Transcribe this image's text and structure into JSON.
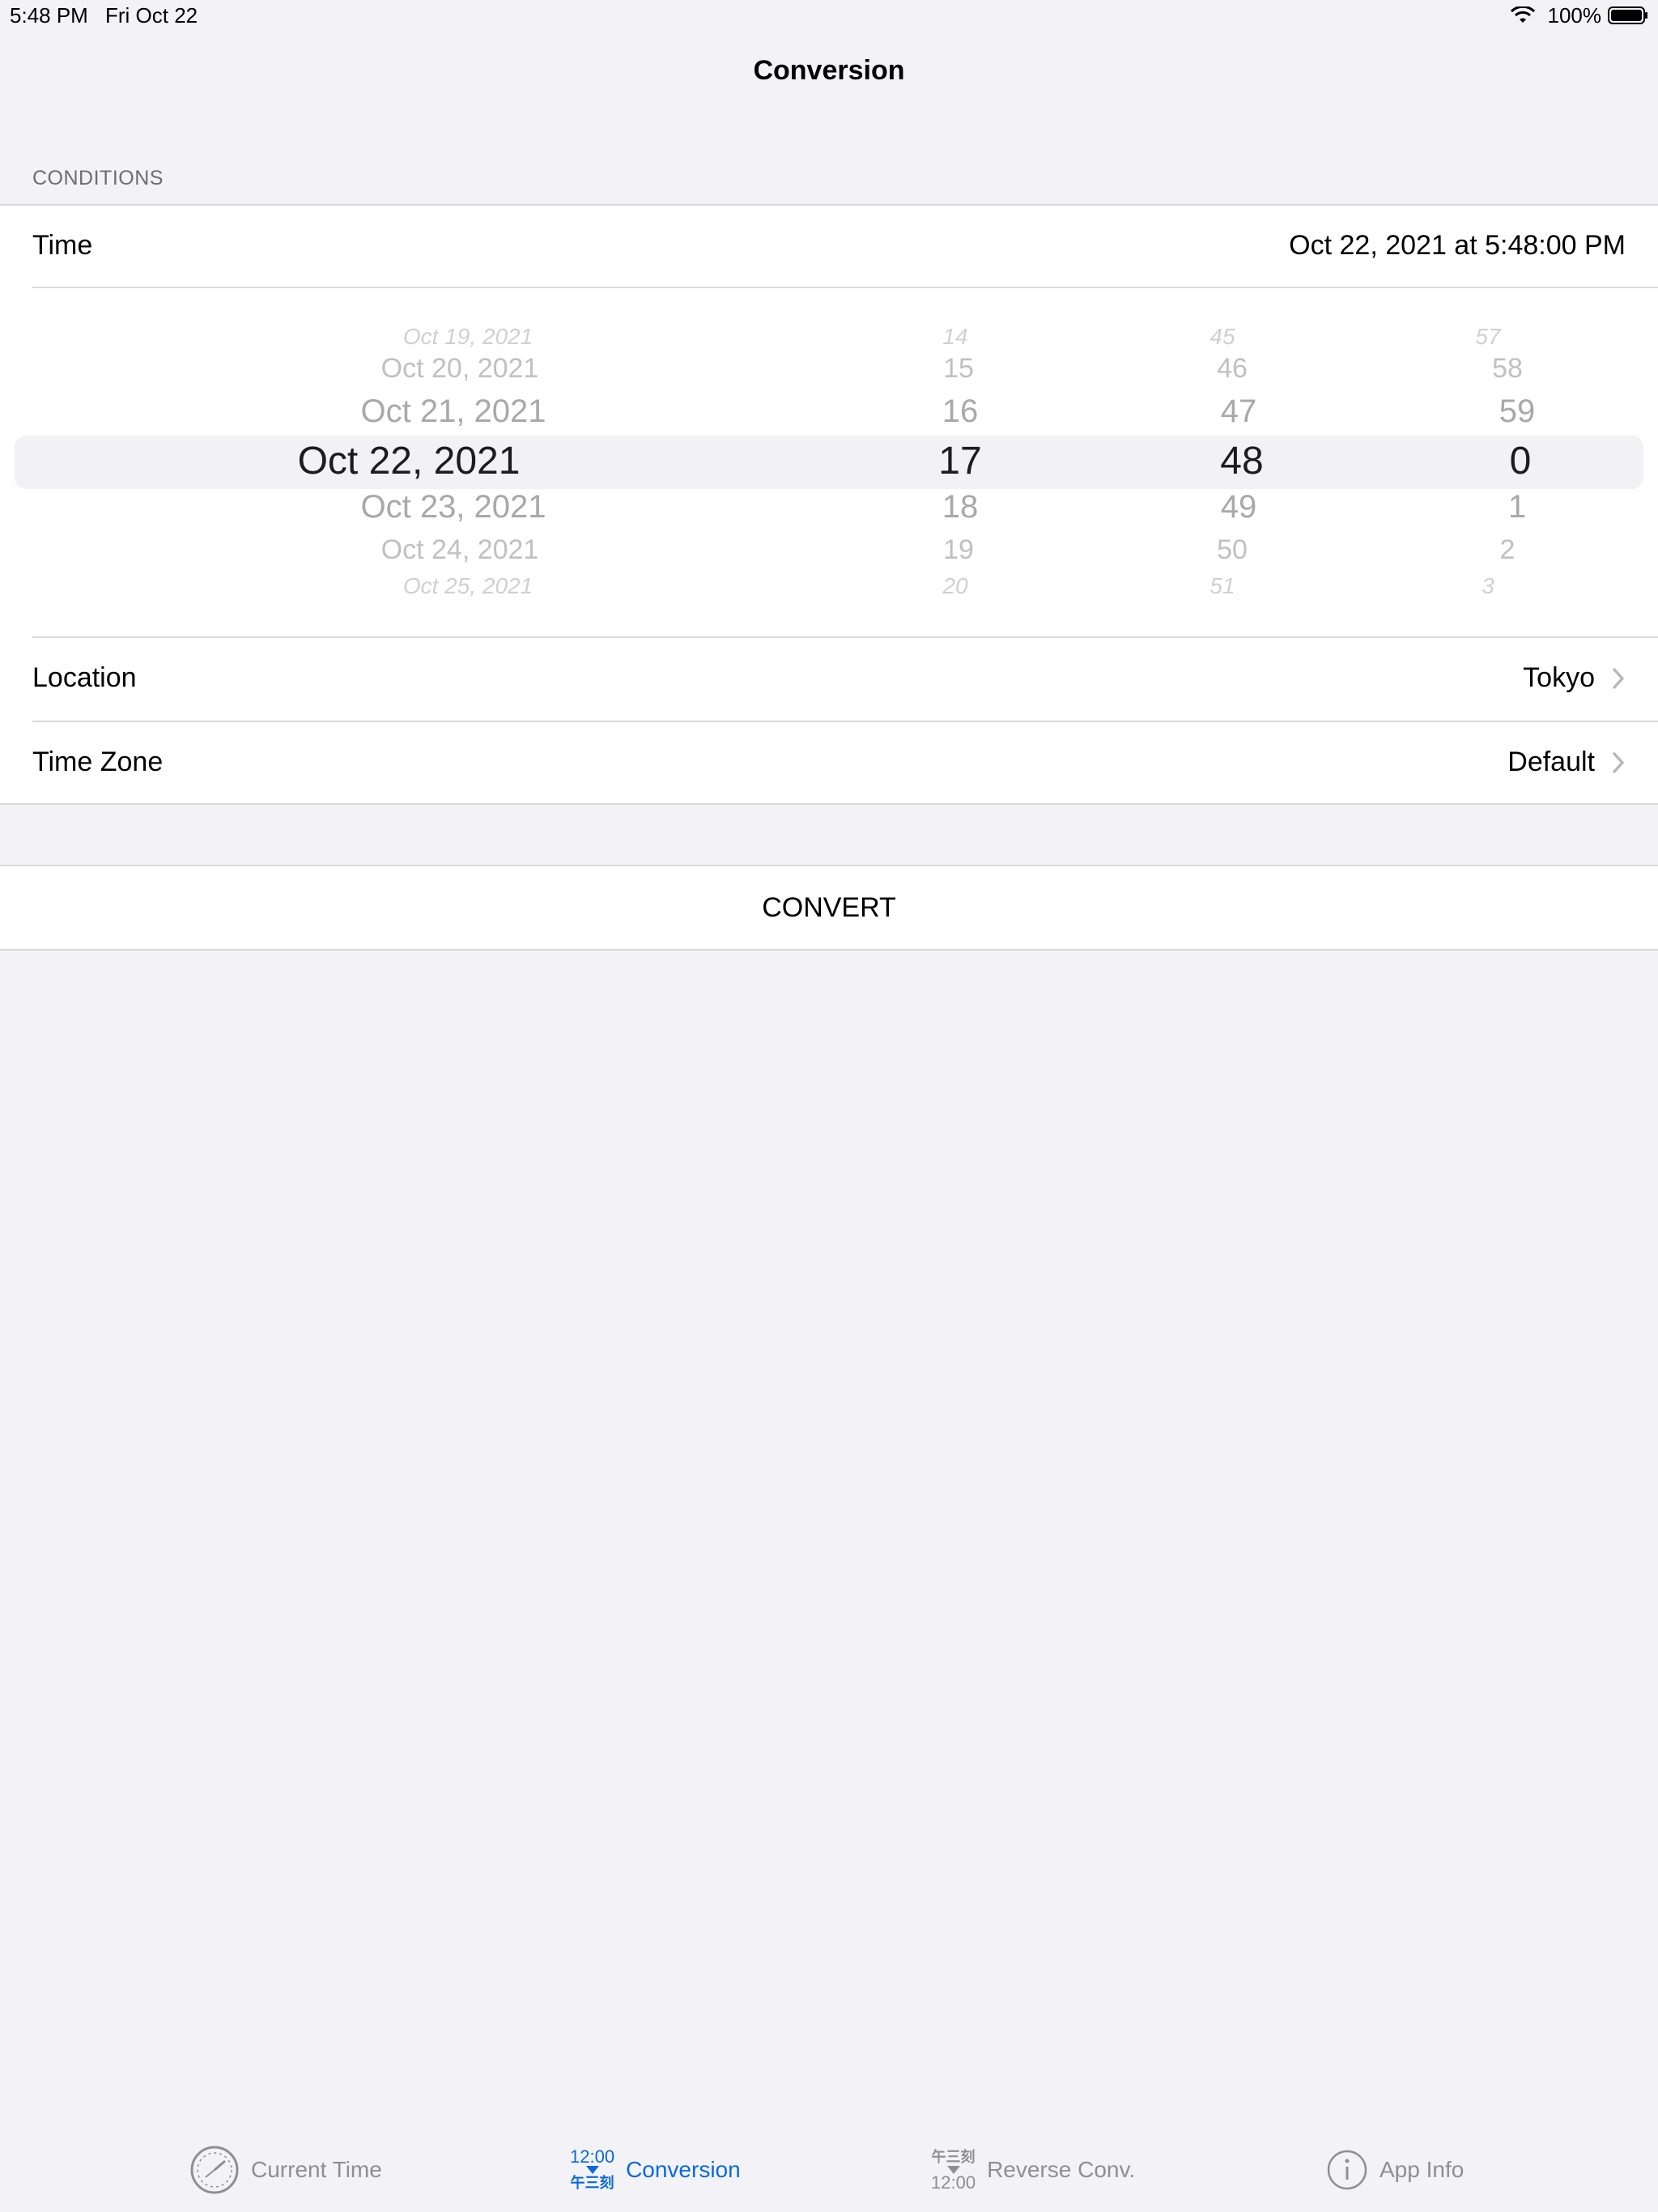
{
  "status_bar": {
    "time": "5:48 PM",
    "date": "Fri Oct 22",
    "battery": "100%"
  },
  "nav": {
    "title": "Conversion"
  },
  "section_header": "CONDITIONS",
  "time_row": {
    "label": "Time",
    "value": "Oct 22, 2021 at 5:48:00 PM"
  },
  "picker": {
    "dates": [
      "Oct 19, 2021",
      "Oct 20, 2021",
      "Oct 21, 2021",
      "Oct 22, 2021",
      "Oct 23, 2021",
      "Oct 24, 2021",
      "Oct 25, 2021"
    ],
    "hours": [
      "14",
      "15",
      "16",
      "17",
      "18",
      "19",
      "20"
    ],
    "minutes": [
      "45",
      "46",
      "47",
      "48",
      "49",
      "50",
      "51"
    ],
    "seconds": [
      "57",
      "58",
      "59",
      "0",
      "1",
      "2",
      "3"
    ]
  },
  "location_row": {
    "label": "Location",
    "value": "Tokyo"
  },
  "timezone_row": {
    "label": "Time Zone",
    "value": "Default"
  },
  "convert_button": "CONVERT",
  "tabs": [
    {
      "label": "Current Time",
      "icon": "clock-icon"
    },
    {
      "label": "Conversion",
      "icon": "conversion-icon",
      "icon_top": "12:00",
      "icon_bottom": "午三刻"
    },
    {
      "label": "Reverse Conv.",
      "icon": "reverse-conversion-icon",
      "icon_top": "午三刻",
      "icon_bottom": "12:00"
    },
    {
      "label": "App Info",
      "icon": "info-icon"
    }
  ],
  "colors": {
    "accent": "#0a6ad8",
    "background": "#f2f2f7"
  }
}
